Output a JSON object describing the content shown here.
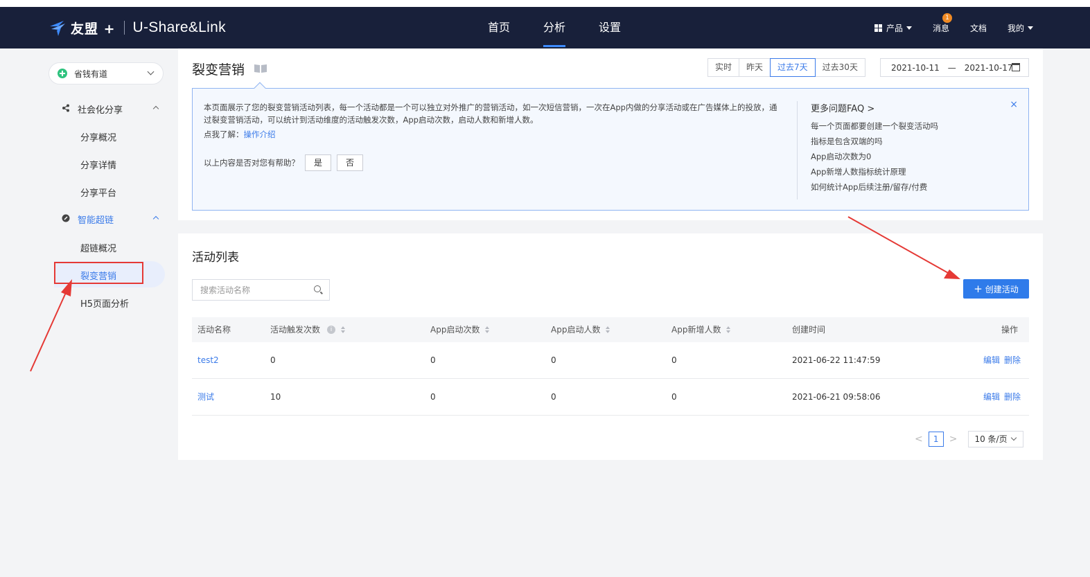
{
  "header": {
    "brand": "友盟 +",
    "product": "U-Share&Link",
    "nav": [
      "首页",
      "分析",
      "设置"
    ],
    "active_nav": "分析",
    "right": {
      "products": "产品",
      "messages": "消息",
      "message_count": "1",
      "docs": "文档",
      "mine": "我的"
    }
  },
  "sidebar": {
    "app_name": "省钱有道",
    "groups": [
      {
        "label": "社会化分享",
        "items": [
          "分享概况",
          "分享详情",
          "分享平台"
        ]
      },
      {
        "label": "智能超链",
        "items": [
          "超链概况",
          "裂变营销",
          "H5页面分析"
        ]
      }
    ],
    "active_item": "裂变营销"
  },
  "page": {
    "title": "裂变营销",
    "time_options": [
      "实时",
      "昨天",
      "过去7天",
      "过去30天"
    ],
    "active_time": "过去7天",
    "date_start": "2021-10-11",
    "date_end": "2021-10-17",
    "date_sep": "—"
  },
  "info": {
    "description": "本页面展示了您的裂变营销活动列表，每一个活动都是一个可以独立对外推广的营销活动，如一次短信营销，一次在App内做的分享活动或在广告媒体上的投放，通过裂变营销活动，可以统计到活动维度的活动触发次数，App启动次数，启动人数和新增人数。",
    "learn_prefix": "点我了解：",
    "learn_link": "操作介绍",
    "helpful_q": "以上内容是否对您有帮助？",
    "yes": "是",
    "no": "否",
    "faq_title": "更多问题FAQ >",
    "faq_items": [
      "每一个页面都要创建一个裂变活动吗",
      "指标是包含双端的吗",
      "App启动次数为0",
      "App新增人数指标统计原理",
      "如何统计App后续注册/留存/付费"
    ],
    "close": "×"
  },
  "list": {
    "title": "活动列表",
    "search_placeholder": "搜索活动名称",
    "create_label": "创建活动",
    "columns": [
      "活动名称",
      "活动触发次数",
      "App启动次数",
      "App启动人数",
      "App新增人数",
      "创建时间",
      "操作"
    ],
    "rows": [
      {
        "name": "test2",
        "triggers": "0",
        "launches": "0",
        "launch_users": "0",
        "new_users": "0",
        "created": "2021-06-22 11:47:59",
        "edit": "编辑",
        "delete": "删除"
      },
      {
        "name": "测试",
        "triggers": "10",
        "launches": "0",
        "launch_users": "0",
        "new_users": "0",
        "created": "2021-06-21 09:58:06",
        "edit": "编辑",
        "delete": "删除"
      }
    ],
    "pagination": {
      "current_page": "1",
      "page_size": "10 条/页",
      "prev": "<",
      "next": ">"
    }
  },
  "colors": {
    "header_bg": "#18203a",
    "accent": "#2f7bea",
    "annotation_red": "#e53935"
  }
}
